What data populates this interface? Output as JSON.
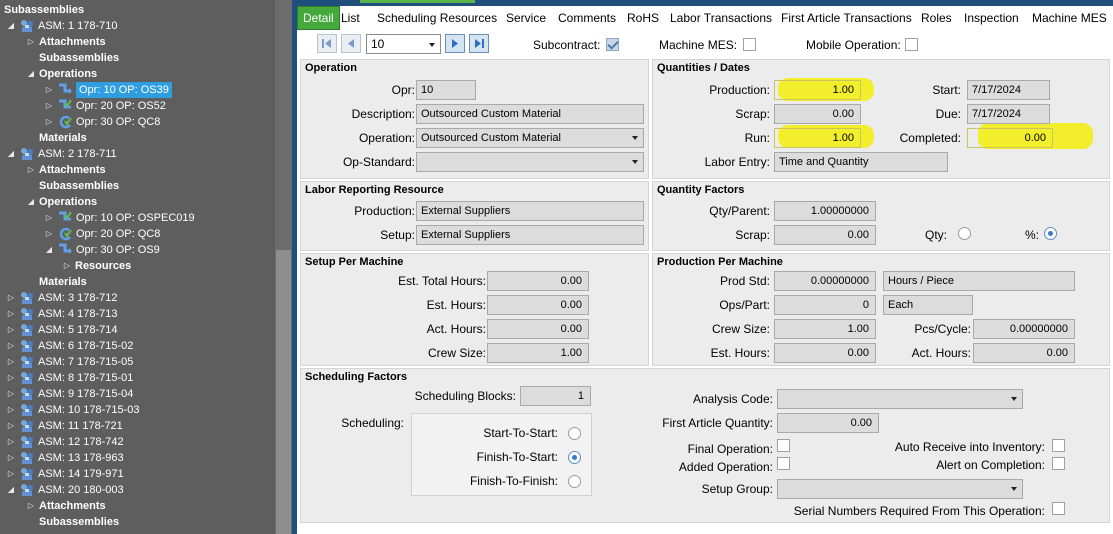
{
  "tree": [
    {
      "label": "Subassemblies",
      "level": "header",
      "bold": true,
      "arrow": "",
      "icon": ""
    },
    {
      "label": "ASM: 1 178-710",
      "level": 0,
      "arrow": "expanded",
      "icon": "assembly-icon"
    },
    {
      "label": "Attachments",
      "level": 1,
      "arrow": "collapsed",
      "icon": "",
      "bold": true
    },
    {
      "label": "Subassemblies",
      "level": 1,
      "arrow": "",
      "icon": "",
      "bold": true
    },
    {
      "label": "Operations",
      "level": 1,
      "arrow": "expanded",
      "icon": "",
      "bold": true
    },
    {
      "label": "Opr: 10 OP: OS39",
      "level": 2,
      "arrow": "collapsed",
      "icon": "operation-icon",
      "selected": true
    },
    {
      "label": "Opr: 20 OP: OS52",
      "level": 2,
      "arrow": "collapsed",
      "icon": "operation-check-icon"
    },
    {
      "label": "Opr: 30 OP: QC8",
      "level": 2,
      "arrow": "collapsed",
      "icon": "operation-cycle-icon"
    },
    {
      "label": "Materials",
      "level": 1,
      "arrow": "",
      "icon": "",
      "bold": true
    },
    {
      "label": "ASM: 2 178-711",
      "level": 0,
      "arrow": "expanded",
      "icon": "assembly-icon"
    },
    {
      "label": "Attachments",
      "level": 1,
      "arrow": "collapsed",
      "icon": "",
      "bold": true
    },
    {
      "label": "Subassemblies",
      "level": 1,
      "arrow": "",
      "icon": "",
      "bold": true
    },
    {
      "label": "Operations",
      "level": 1,
      "arrow": "expanded",
      "icon": "",
      "bold": true
    },
    {
      "label": "Opr: 10 OP: OSPEC019",
      "level": 2,
      "arrow": "collapsed",
      "icon": "operation-check-icon"
    },
    {
      "label": "Opr: 20 OP: QC8",
      "level": 2,
      "arrow": "collapsed",
      "icon": "operation-cycle-icon"
    },
    {
      "label": "Opr: 30 OP: OS9",
      "level": 2,
      "arrow": "expanded",
      "icon": "operation-icon"
    },
    {
      "label": "Resources",
      "level": 3,
      "arrow": "collapsed",
      "icon": "",
      "bold": true
    },
    {
      "label": "Materials",
      "level": 1,
      "arrow": "",
      "icon": "",
      "bold": true
    },
    {
      "label": "ASM: 3 178-712",
      "level": 0,
      "arrow": "collapsed",
      "icon": "assembly-icon"
    },
    {
      "label": "ASM: 4 178-713",
      "level": 0,
      "arrow": "collapsed",
      "icon": "assembly-icon"
    },
    {
      "label": "ASM: 5 178-714",
      "level": 0,
      "arrow": "collapsed",
      "icon": "assembly-icon"
    },
    {
      "label": "ASM: 6 178-715-02",
      "level": 0,
      "arrow": "collapsed",
      "icon": "assembly-icon"
    },
    {
      "label": "ASM: 7 178-715-05",
      "level": 0,
      "arrow": "collapsed",
      "icon": "assembly-icon"
    },
    {
      "label": "ASM: 8 178-715-01",
      "level": 0,
      "arrow": "collapsed",
      "icon": "assembly-icon"
    },
    {
      "label": "ASM: 9 178-715-04",
      "level": 0,
      "arrow": "collapsed",
      "icon": "assembly-icon"
    },
    {
      "label": "ASM: 10 178-715-03",
      "level": 0,
      "arrow": "collapsed",
      "icon": "assembly-icon"
    },
    {
      "label": "ASM: 11 178-721",
      "level": 0,
      "arrow": "collapsed",
      "icon": "assembly-icon"
    },
    {
      "label": "ASM: 12 178-742",
      "level": 0,
      "arrow": "collapsed",
      "icon": "assembly-icon"
    },
    {
      "label": "ASM: 13 178-963",
      "level": 0,
      "arrow": "collapsed",
      "icon": "assembly-icon"
    },
    {
      "label": "ASM: 14 179-971",
      "level": 0,
      "arrow": "collapsed",
      "icon": "assembly-icon"
    },
    {
      "label": "ASM: 20 180-003",
      "level": 0,
      "arrow": "expanded",
      "icon": "assembly-icon"
    },
    {
      "label": "Attachments",
      "level": 1,
      "arrow": "collapsed",
      "icon": "",
      "bold": true
    },
    {
      "label": "Subassemblies",
      "level": 1,
      "arrow": "",
      "icon": "",
      "bold": true
    }
  ],
  "tabs": [
    "Detail",
    "List",
    "Scheduling Resources",
    "Service",
    "Comments",
    "RoHS",
    "Labor Transactions",
    "First Article Transactions",
    "Roles",
    "Inspection",
    "Machine MES"
  ],
  "toolbar": {
    "nav_value": "10",
    "subcontract_label": "Subcontract:",
    "machine_mes_label": "Machine MES:",
    "mobile_operation_label": "Mobile Operation:"
  },
  "operation": {
    "title": "Operation",
    "opr_label": "Opr:",
    "opr_value": "10",
    "description_label": "Description:",
    "description_value": "Outsourced Custom Material",
    "operation_label": "Operation:",
    "operation_value": "Outsourced Custom Material",
    "opstandard_label": "Op-Standard:",
    "opstandard_value": ""
  },
  "quantities": {
    "title": "Quantities / Dates",
    "production_label": "Production:",
    "production_value": "1.00",
    "scrap_label": "Scrap:",
    "scrap_value": "0.00",
    "run_label": "Run:",
    "run_value": "1.00",
    "labor_entry_label": "Labor Entry:",
    "labor_entry_value": "Time and Quantity",
    "start_label": "Start:",
    "start_value": "7/17/2024",
    "due_label": "Due:",
    "due_value": "7/17/2024",
    "completed_label": "Completed:",
    "completed_value": "0.00"
  },
  "labor_reporting": {
    "title": "Labor Reporting Resource",
    "production_label": "Production:",
    "production_value": "External Suppliers",
    "setup_label": "Setup:",
    "setup_value": "External Suppliers"
  },
  "quantity_factors": {
    "title": "Quantity Factors",
    "qty_parent_label": "Qty/Parent:",
    "qty_parent_value": "1.00000000",
    "scrap_label": "Scrap:",
    "scrap_value": "0.00",
    "qty_label": "Qty:",
    "pct_label": "%:"
  },
  "setup_per_machine": {
    "title": "Setup Per Machine",
    "est_total_label": "Est. Total Hours:",
    "est_total_value": "0.00",
    "est_hours_label": "Est. Hours:",
    "est_hours_value": "0.00",
    "act_hours_label": "Act. Hours:",
    "act_hours_value": "0.00",
    "crew_size_label": "Crew Size:",
    "crew_size_value": "1.00"
  },
  "production_per_machine": {
    "title": "Production Per Machine",
    "prod_std_label": "Prod Std:",
    "prod_std_value": "0.00000000",
    "prod_std_unit": "Hours / Piece",
    "ops_part_label": "Ops/Part:",
    "ops_part_value": "0",
    "ops_part_unit": "Each",
    "crew_size_label": "Crew Size:",
    "crew_size_value": "1.00",
    "pcs_cycle_label": "Pcs/Cycle:",
    "pcs_cycle_value": "0.00000000",
    "est_hours_label": "Est. Hours:",
    "est_hours_value": "0.00",
    "act_hours_label": "Act. Hours:",
    "act_hours_value": "0.00"
  },
  "scheduling": {
    "title": "Scheduling Factors",
    "blocks_label": "Scheduling Blocks:",
    "blocks_value": "1",
    "scheduling_label": "Scheduling:",
    "start_to_start": "Start-To-Start:",
    "finish_to_start": "Finish-To-Start:",
    "finish_to_finish": "Finish-To-Finish:",
    "analysis_code_label": "Analysis Code:",
    "analysis_code_value": "",
    "first_article_label": "First Article Quantity:",
    "first_article_value": "0.00",
    "final_operation_label": "Final Operation:",
    "added_operation_label": "Added Operation:",
    "setup_group_label": "Setup Group:",
    "setup_group_value": "",
    "auto_receive_label": "Auto Receive into Inventory:",
    "alert_completion_label": "Alert on Completion:",
    "serial_numbers_label": "Serial Numbers Required From This Operation:"
  }
}
